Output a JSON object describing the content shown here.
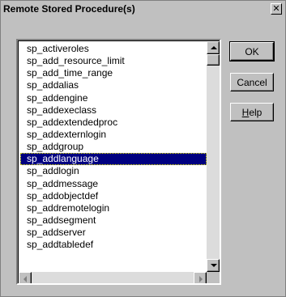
{
  "window": {
    "title": "Remote Stored Procedure(s)",
    "close_glyph": "✕"
  },
  "list": {
    "items": [
      "sp_activeroles",
      "sp_add_resource_limit",
      "sp_add_time_range",
      "sp_addalias",
      "sp_addengine",
      "sp_addexeclass",
      "sp_addextendedproc",
      "sp_addexternlogin",
      "sp_addgroup",
      "sp_addlanguage",
      "sp_addlogin",
      "sp_addmessage",
      "sp_addobjectdef",
      "sp_addremotelogin",
      "sp_addsegment",
      "sp_addserver",
      "sp_addtabledef"
    ],
    "selected_index": 9
  },
  "buttons": {
    "ok": "OK",
    "cancel": "Cancel",
    "help_accel": "H",
    "help_rest": "elp"
  },
  "colors": {
    "dialog_bg": "#c0c0c0",
    "selection_bg": "#000080",
    "selection_fg": "#ffffff"
  },
  "icons": {
    "close": "close-icon",
    "scroll_up": "arrow-up-icon",
    "scroll_down": "arrow-down-icon",
    "scroll_left": "arrow-left-icon",
    "scroll_right": "arrow-right-icon"
  }
}
